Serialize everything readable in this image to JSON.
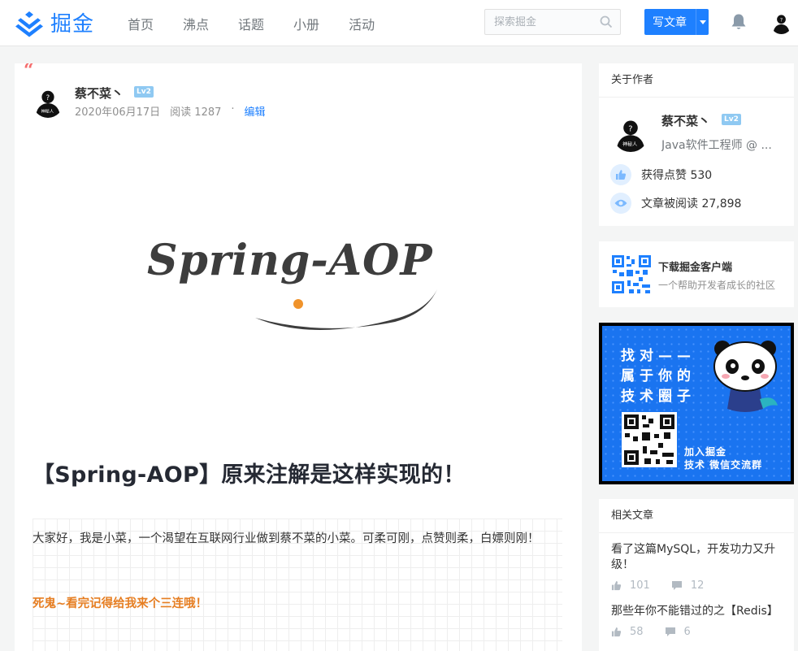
{
  "header": {
    "logo_text": "掘金",
    "nav": [
      "首页",
      "沸点",
      "话题",
      "小册",
      "活动"
    ],
    "search_placeholder": "探索掘金",
    "write_label": "写文章"
  },
  "article": {
    "author": "蔡不菜丶",
    "level": "Lv2",
    "date": "2020年06月17日",
    "reads": "阅读 1287",
    "separator": "·",
    "edit": "编辑",
    "cover_text": "Spring-AOP",
    "title": "【Spring-AOP】原来注解是这样实现的！",
    "paragraph": "大家好，我是小菜，一个渴望在互联网行业做到蔡不菜的小菜。可柔可刚，点赞则柔，白嫖则刚！",
    "emphasis": "死鬼~看完记得给我来个三连哦！",
    "avatar_text": "神秘人"
  },
  "about_author": {
    "title": "关于作者",
    "name": "蔡不菜丶",
    "level": "Lv2",
    "job": "Java软件工程师 @ ...",
    "likes": "获得点赞 530",
    "reads": "文章被阅读 27,898"
  },
  "download": {
    "title": "下载掘金客户端",
    "subtitle": "一个帮助开发者成长的社区"
  },
  "banner": {
    "line1": "找对——",
    "line2": "属于你的",
    "line3": "技术圈子",
    "join1": "加入掘金",
    "join2": "技术 微信交流群"
  },
  "related": {
    "title": "相关文章",
    "items": [
      {
        "title": "看了这篇MySQL，开发功力又升级！",
        "likes": "101",
        "comments": "12"
      },
      {
        "title": "那些年你不能错过的之【Redis】",
        "likes": "58",
        "comments": "6"
      }
    ]
  },
  "colors": {
    "brand": "#1e80ff",
    "emphasis": "#e67e22",
    "quote": "#f56c6c"
  }
}
